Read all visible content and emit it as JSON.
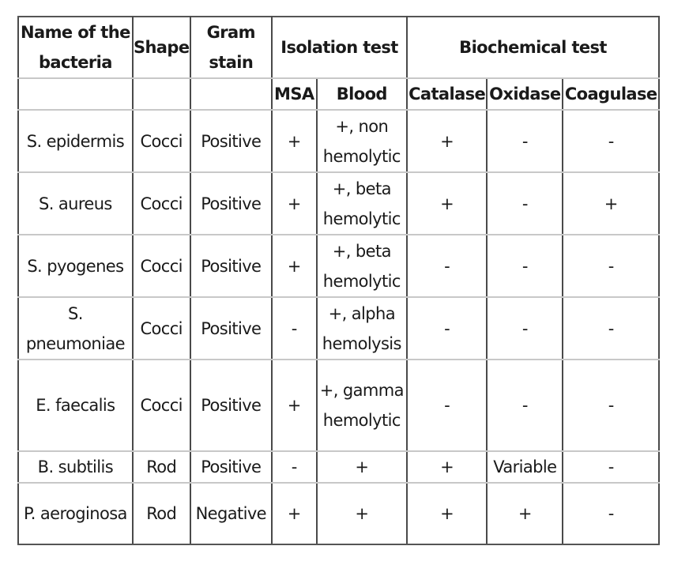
{
  "table": {
    "headers": {
      "name": "Name of the bacteria",
      "shape": "Shape",
      "gram_stain": "Gram stain",
      "isolation_test": "Isolation test",
      "biochemical_test": "Biochemical test",
      "sub": {
        "msa": "MSA",
        "blood": "Blood",
        "catalase": "Catalase",
        "oxidase": "Oxidase",
        "coagulase": "Coagulase"
      }
    },
    "rows": [
      {
        "name": "S. epidermis",
        "shape": "Cocci",
        "gram": "Positive",
        "msa": "+",
        "blood": "+, non hemolytic",
        "catalase": "+",
        "oxidase": "-",
        "coagulase": "-"
      },
      {
        "name": "S. aureus",
        "shape": "Cocci",
        "gram": "Positive",
        "msa": "+",
        "blood": "+, beta hemolytic",
        "catalase": "+",
        "oxidase": "-",
        "coagulase": "+"
      },
      {
        "name": "S. pyogenes",
        "shape": "Cocci",
        "gram": "Positive",
        "msa": "+",
        "blood": "+, beta hemolytic",
        "catalase": "-",
        "oxidase": "-",
        "coagulase": "-"
      },
      {
        "name": "S. pneumoniae",
        "shape": "Cocci",
        "gram": "Positive",
        "msa": "-",
        "blood": "+, alpha hemolysis",
        "catalase": "-",
        "oxidase": "-",
        "coagulase": "-"
      },
      {
        "name": "E. faecalis",
        "shape": "Cocci",
        "gram": "Positive",
        "msa": "+",
        "blood": "+, gamma hemolytic",
        "catalase": "-",
        "oxidase": "-",
        "coagulase": "-"
      },
      {
        "name": "B. subtilis",
        "shape": "Rod",
        "gram": "Positive",
        "msa": "-",
        "blood": "+",
        "catalase": "+",
        "oxidase": "Variable",
        "coagulase": "-"
      },
      {
        "name": "P. aeroginosa",
        "shape": "Rod",
        "gram": "Negative",
        "msa": "+",
        "blood": "+",
        "catalase": "+",
        "oxidase": "+",
        "coagulase": "-"
      }
    ]
  }
}
